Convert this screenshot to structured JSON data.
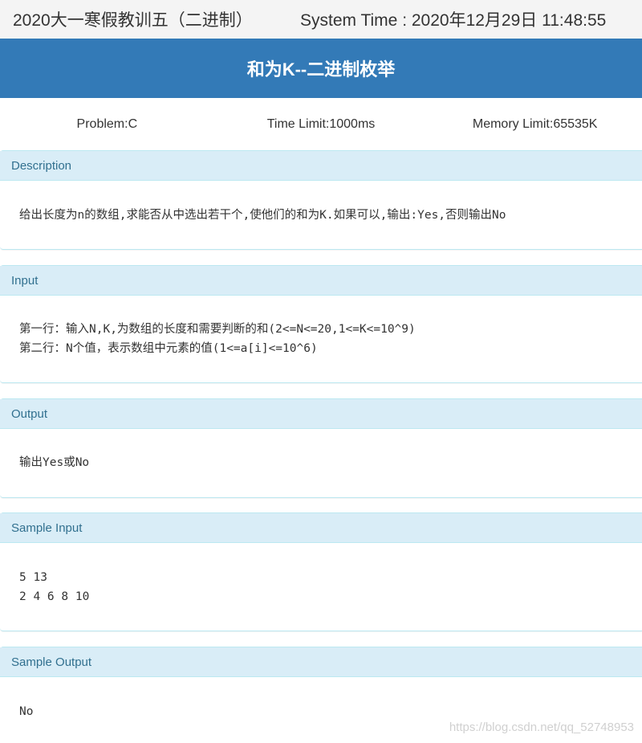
{
  "header": {
    "contest": "2020大一寒假教训五（二进制）",
    "system_time": "System Time : 2020年12月29日 11:48:55"
  },
  "problem": {
    "title": "和为K--二进制枚举",
    "problem_id": "Problem:C",
    "time_limit": "Time Limit:1000ms",
    "memory_limit": "Memory Limit:65535K"
  },
  "sections": {
    "description": {
      "heading": "Description",
      "lines": [
        "给出长度为n的数组,求能否从中选出若干个,使他们的和为K.如果可以,输出:Yes,否则输出No"
      ]
    },
    "input": {
      "heading": "Input",
      "lines": [
        "第一行：输入N,K,为数组的长度和需要判断的和(2<=N<=20,1<=K<=10^9)",
        "第二行：N个值，表示数组中元素的值(1<=a[i]<=10^6)"
      ]
    },
    "output": {
      "heading": "Output",
      "lines": [
        "输出Yes或No"
      ]
    },
    "sample_input": {
      "heading": "Sample Input",
      "lines": [
        "5 13",
        "2 4 6 8 10"
      ]
    },
    "sample_output": {
      "heading": "Sample Output",
      "lines": [
        "No"
      ]
    }
  },
  "watermark": "https://blog.csdn.net/qq_52748953",
  "colors": {
    "title_bar": "#337ab7",
    "panel_heading_bg": "#d9edf7",
    "panel_heading_text": "#31708f",
    "panel_border": "#bce8f1",
    "top_bar_bg": "#f4f4f4"
  }
}
